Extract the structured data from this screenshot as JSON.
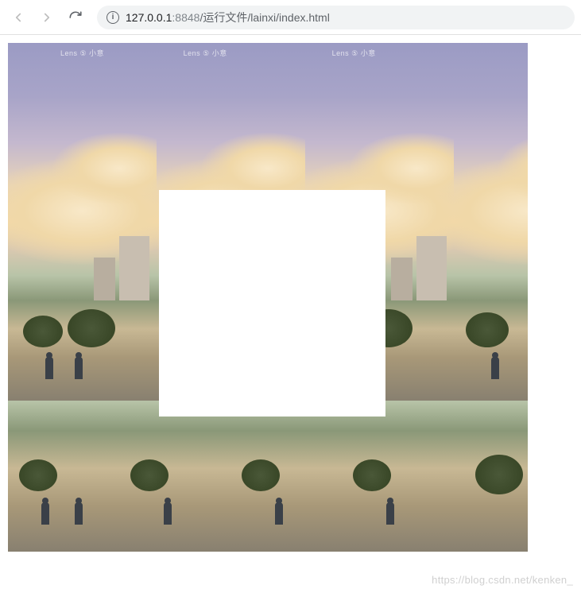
{
  "browser": {
    "url_host": "127.0.0.1",
    "url_port": ":8848",
    "url_path": "/运行文件/lainxi/index.html",
    "info_glyph": "i"
  },
  "page": {
    "watermark_label": "Lens ⑤ 小意",
    "footer_watermark": "https://blog.csdn.net/kenken_"
  }
}
